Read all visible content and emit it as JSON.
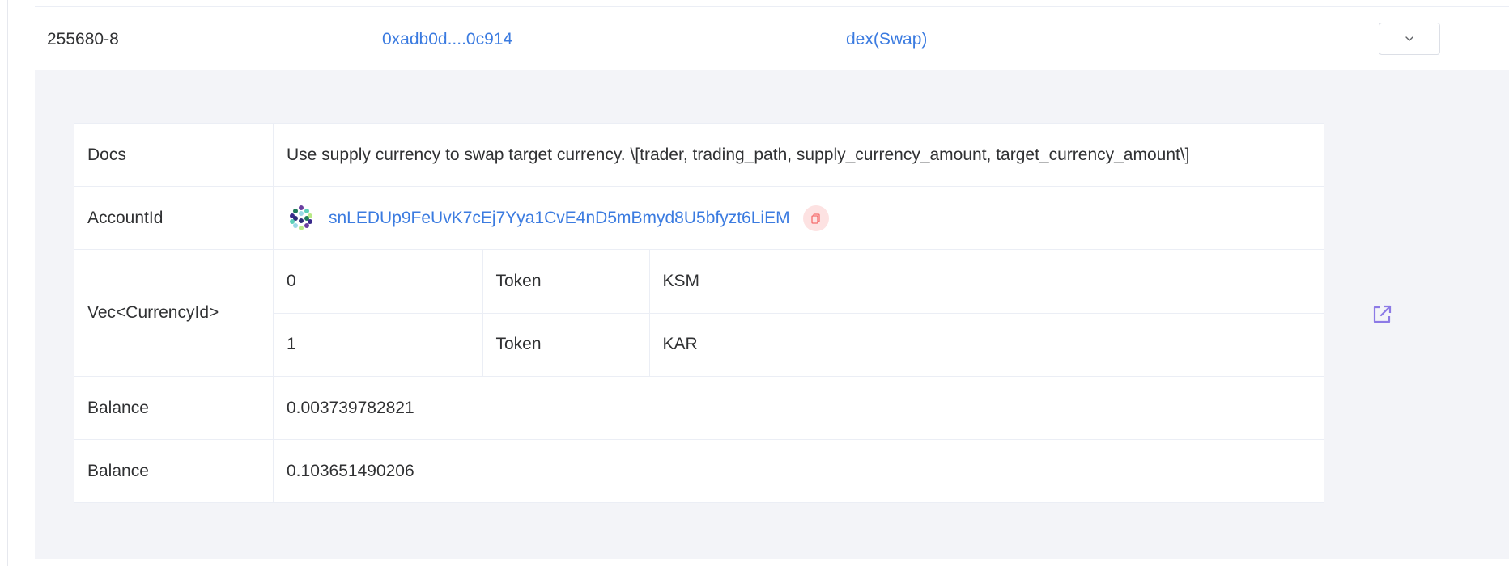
{
  "row": {
    "id": "255680-8",
    "hash": "0xadb0d....0c914",
    "call": "dex(Swap)"
  },
  "params": {
    "docs_label": "Docs",
    "docs_value": "Use supply currency to swap target currency. \\[trader, trading_path, supply_currency_amount, target_currency_amount\\]",
    "account_label": "AccountId",
    "account_value": "snLEDUp9FeUvK7cEj7Yya1CvE4nD5mBmyd8U5bfyzt6LiEM",
    "vec_label": "Vec<CurrencyId>",
    "vec_items": [
      {
        "index": "0",
        "type": "Token",
        "value": "KSM"
      },
      {
        "index": "1",
        "type": "Token",
        "value": "KAR"
      }
    ],
    "balances": [
      {
        "label": "Balance",
        "value": "0.003739782821"
      },
      {
        "label": "Balance",
        "value": "0.103651490206"
      }
    ]
  },
  "icons": {
    "expand": "chevron-down-icon",
    "copy": "copy-icon",
    "external": "external-link-icon",
    "avatar": "identicon-avatar"
  },
  "colors": {
    "link": "#3b7be0",
    "panel_bg": "#f3f4f8",
    "copy_bg": "#fde2e2",
    "copy_fg": "#f56c6c",
    "external": "#8c7ae6"
  }
}
